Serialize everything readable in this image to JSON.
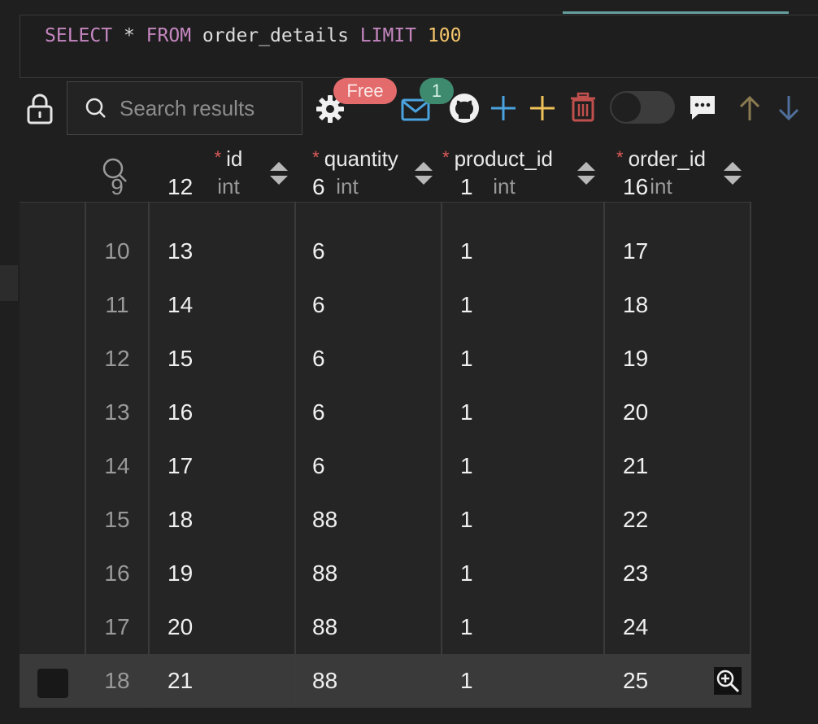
{
  "query": {
    "keyword_select": "SELECT",
    "star": "*",
    "keyword_from": "FROM",
    "table": "order_details",
    "keyword_limit": "LIMIT",
    "limit_value": "100"
  },
  "toolbar": {
    "search_placeholder": "Search results",
    "free_badge": "Free",
    "notification_count": "1",
    "toggle_on": false,
    "colors": {
      "add_row": "#4aa3df",
      "add_column": "#f0c35a",
      "delete": "#c0504d",
      "sort_up": "#8a7a50",
      "sort_down": "#4f6f9a"
    }
  },
  "grid": {
    "columns": [
      {
        "name": "id",
        "type": "int",
        "required": true
      },
      {
        "name": "quantity",
        "type": "int",
        "required": true
      },
      {
        "name": "product_id",
        "type": "int",
        "required": true
      },
      {
        "name": "order_id",
        "type": "int",
        "required": true
      }
    ],
    "required_marker": "*",
    "partial_row": {
      "num": "9",
      "id": "12",
      "quantity": "6",
      "product_id": "1",
      "order_id": "16"
    },
    "rows": [
      {
        "num": "10",
        "id": "13",
        "quantity": "6",
        "product_id": "1",
        "order_id": "17"
      },
      {
        "num": "11",
        "id": "14",
        "quantity": "6",
        "product_id": "1",
        "order_id": "18"
      },
      {
        "num": "12",
        "id": "15",
        "quantity": "6",
        "product_id": "1",
        "order_id": "19"
      },
      {
        "num": "13",
        "id": "16",
        "quantity": "6",
        "product_id": "1",
        "order_id": "20"
      },
      {
        "num": "14",
        "id": "17",
        "quantity": "6",
        "product_id": "1",
        "order_id": "21"
      },
      {
        "num": "15",
        "id": "18",
        "quantity": "88",
        "product_id": "1",
        "order_id": "22"
      },
      {
        "num": "16",
        "id": "19",
        "quantity": "88",
        "product_id": "1",
        "order_id": "23"
      },
      {
        "num": "17",
        "id": "20",
        "quantity": "88",
        "product_id": "1",
        "order_id": "24"
      },
      {
        "num": "18",
        "id": "21",
        "quantity": "88",
        "product_id": "1",
        "order_id": "25"
      }
    ],
    "highlighted_row": "18"
  }
}
